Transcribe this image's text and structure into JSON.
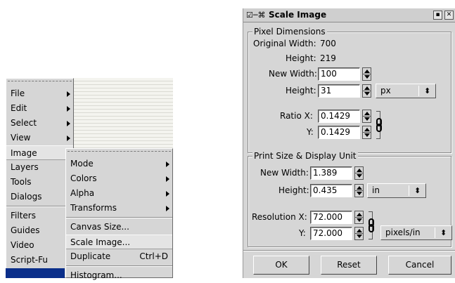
{
  "image_menu": {
    "items": [
      {
        "label": "File",
        "submenu": true
      },
      {
        "label": "Edit",
        "submenu": true
      },
      {
        "label": "Select",
        "submenu": true
      },
      {
        "label": "View",
        "submenu": true
      },
      {
        "label": "Image",
        "submenu": true,
        "active": true
      },
      {
        "label": "Layers",
        "submenu": true
      },
      {
        "label": "Tools",
        "submenu": true
      },
      {
        "label": "Dialogs",
        "submenu": true
      },
      {
        "label": "Filters",
        "submenu": true
      },
      {
        "label": "Guides",
        "submenu": true
      },
      {
        "label": "Video",
        "submenu": true
      },
      {
        "label": "Script-Fu",
        "submenu": true
      }
    ]
  },
  "image_submenu": {
    "items": [
      {
        "label": "Mode",
        "submenu": true
      },
      {
        "label": "Colors",
        "submenu": true
      },
      {
        "label": "Alpha",
        "submenu": true
      },
      {
        "label": "Transforms",
        "submenu": true
      },
      {
        "label": "Canvas Size..."
      },
      {
        "label": "Scale Image...",
        "highlighted": true
      },
      {
        "label": "Duplicate",
        "accel": "Ctrl+D"
      },
      {
        "label": "Histogram..."
      }
    ]
  },
  "dialog": {
    "title": "Scale Image",
    "pixel_dimensions": {
      "frame_label": "Pixel Dimensions",
      "original_width_label": "Original Width:",
      "original_width": "700",
      "original_height_label": "Height:",
      "original_height": "219",
      "new_width_label": "New Width:",
      "new_width": "100",
      "height_label": "Height:",
      "height": "31",
      "unit": "px",
      "ratio_x_label": "Ratio X:",
      "ratio_x": "0.1429",
      "ratio_y_label": "Y:",
      "ratio_y": "0.1429"
    },
    "print_size": {
      "frame_label": "Print Size & Display Unit",
      "new_width_label": "New Width:",
      "new_width": "1.389",
      "height_label": "Height:",
      "height": "0.435",
      "unit": "in",
      "resolution_x_label": "Resolution X:",
      "resolution_x": "72.000",
      "resolution_y_label": "Y:",
      "resolution_y": "72.000",
      "resolution_unit": "pixels/in"
    },
    "buttons": {
      "ok": "OK",
      "reset": "Reset",
      "cancel": "Cancel"
    }
  }
}
